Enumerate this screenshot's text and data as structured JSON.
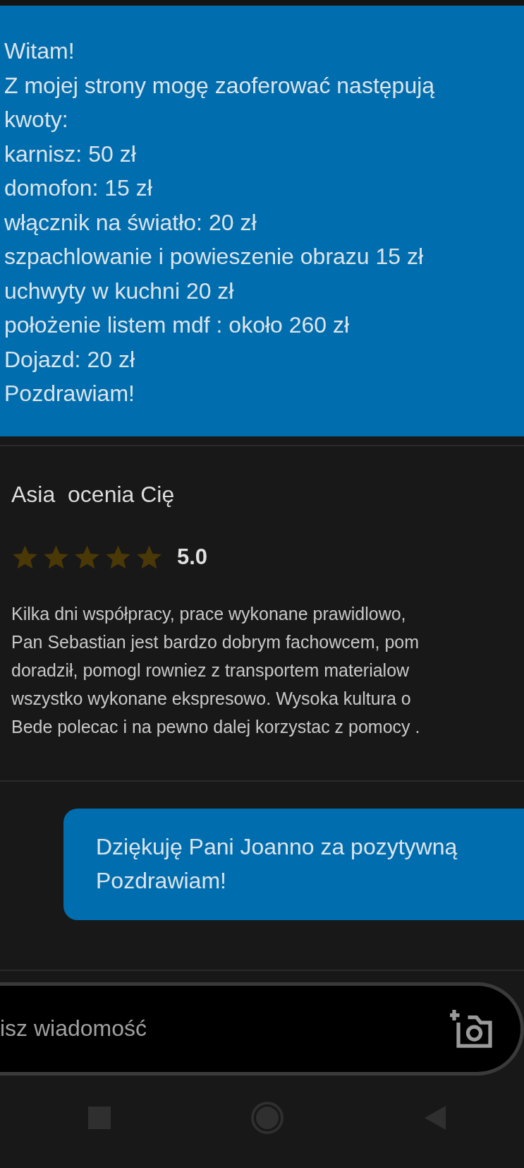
{
  "offer_message": {
    "lines": [
      "Witam!",
      "Z mojej strony mogę zaoferować następują",
      "kwoty:",
      "karnisz: 50 zł",
      "domofon: 15 zł",
      "włącznik na światło: 20 zł",
      "szpachlowanie i powieszenie obrazu 15 zł",
      "uchwyty w kuchni 20 zł",
      "położenie listem mdf : około 260 zł",
      "Dojazd: 20 zł",
      "Pozdrawiam!"
    ]
  },
  "review": {
    "title": "Asia  ocenia Cię",
    "stars": 5,
    "rating": "5.0",
    "lines": [
      "Kilka dni współpracy, prace wykonane prawidlowo,",
      "Pan Sebastian jest bardzo dobrym fachowcem, pom",
      "doradził, pomogl rowniez z transportem materialow",
      "wszystko wykonane ekspresowo. Wysoka kultura o",
      "Bede polecac i na pewno dalej korzystac z pomocy ."
    ]
  },
  "reply_message": {
    "lines": [
      "Dziękuję Pani Joanno za pozytywną",
      "Pozdrawiam!"
    ]
  },
  "composer": {
    "placeholder": "isz wiadomość"
  }
}
